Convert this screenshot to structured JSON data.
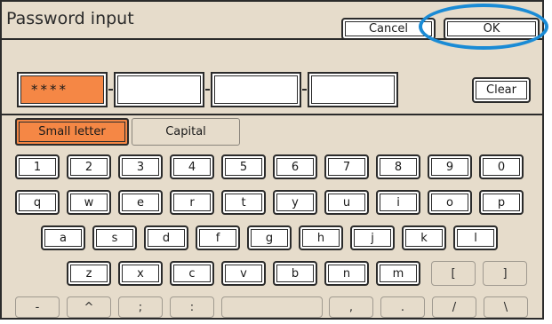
{
  "title": "Password input",
  "buttons": {
    "cancel": "Cancel",
    "ok": "OK",
    "clear": "Clear"
  },
  "password": {
    "field1": "****",
    "field2": "",
    "field3": "",
    "field4": ""
  },
  "tabs": {
    "small": "Small letter",
    "capital": "Capital"
  },
  "keys": {
    "row1": [
      "1",
      "2",
      "3",
      "4",
      "5",
      "6",
      "7",
      "8",
      "9",
      "0"
    ],
    "row2": [
      "q",
      "w",
      "e",
      "r",
      "t",
      "y",
      "u",
      "i",
      "o",
      "p"
    ],
    "row3": [
      "a",
      "s",
      "d",
      "f",
      "g",
      "h",
      "j",
      "k",
      "l"
    ],
    "row4": [
      "z",
      "x",
      "c",
      "v",
      "b",
      "n",
      "m",
      "[",
      "]"
    ],
    "row5": [
      "-",
      "^",
      ";",
      ":",
      "",
      ",",
      ".",
      "/",
      "\\"
    ]
  },
  "colors": {
    "accent": "#f58745",
    "highlight_ring": "#1a8bd5",
    "panel": "#e6dccb"
  }
}
